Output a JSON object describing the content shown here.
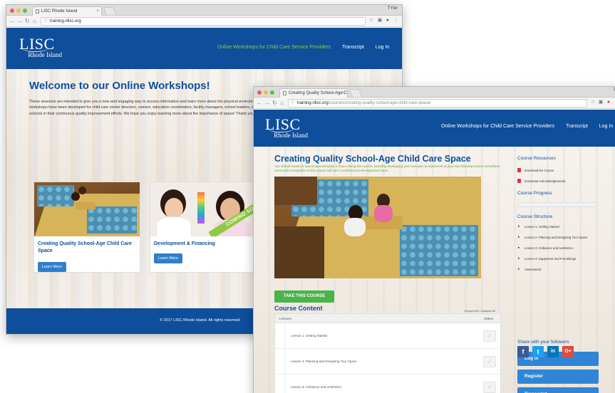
{
  "window1": {
    "tab_title": "LISC Rhode Island",
    "user_label": "TYler",
    "url": "training.rilisc.org",
    "logo": {
      "main": "LISC",
      "sub": "Rhode Island"
    },
    "menu": [
      "Online Workshops for Child Care Service Providers",
      "Transcript",
      "Log In"
    ],
    "welcome": "Welcome to our Online Workshops!",
    "intro": "These sessions are intended to give you a new and engaging way to access information and learn more about the physical environment of child care spaces at your own convenience. These self-guided, interactive workshops have been developed for child care center directors, owners, education coordinators, facility managers, school leaders, architects, landscape designers, and individuals working to support centers and schools in their continuous quality improvement efforts. We hope you enjoy learning more about the importance of space! Thank you.",
    "cards": [
      {
        "title": "Creating Quality School-Age Child Care Space",
        "button": "Learn More"
      },
      {
        "title": "Development & Financing",
        "button": "Learn More",
        "ribbon": "COMING SOON"
      }
    ],
    "footer": "© 2017 LISC Rhode Island. All rights reserved."
  },
  "window2": {
    "tab_title": "Creating Quality School-Age C",
    "user_label": "TY",
    "url_host": "training.rilisc.org",
    "url_path": "/courses/creating-quality-school-age-child-care-space/",
    "logo": {
      "main": "LISC",
      "sub": "Rhode Island"
    },
    "menu": [
      "Online Workshops for Child Care Service Providers",
      "Transcript",
      "Log In"
    ],
    "course_title": "Creating Quality School-Age Child Care Space",
    "course_note": "You should expect to spend approximately 3 hours taking this course, including developing your own plan to implement at your site following course completion. Successful completion of this course will earn 3 professional development hours",
    "take_button": "TAKE THIS COURSE",
    "content_heading": "Course Content",
    "expand_collapse": "Expand All | Collapse All",
    "table_headers": {
      "lessons": "Lessons",
      "status": "Status"
    },
    "lessons": [
      "Lesson 1: Getting Started",
      "Lesson 2: Planning and Designing Your Space",
      "Lesson 3: Ambiance and Aesthetics"
    ],
    "sidebar": {
      "resources_heading": "Course Resources",
      "resources": [
        "Download the Course",
        "Download Acknowledgements"
      ],
      "progress_heading": "Course Progress",
      "structure_heading": "Course Structure",
      "structure": [
        "Lesson 1: Getting Started",
        "Lesson 2: Planning and Designing Your Space",
        "Lesson 3: Ambiance and Aesthetics",
        "Lesson 4: Equipment and Furnishings",
        "Assessment"
      ],
      "buttons": [
        "Log In",
        "Register",
        "Transcript"
      ],
      "share": "Share with your followers",
      "social": [
        "f",
        "t",
        "in",
        "G+"
      ]
    }
  },
  "colors": {
    "brand_blue": "#0e4e9b",
    "accent_green": "#8fce3c",
    "button_blue": "#2f86d6",
    "take_green": "#4ab34a"
  }
}
